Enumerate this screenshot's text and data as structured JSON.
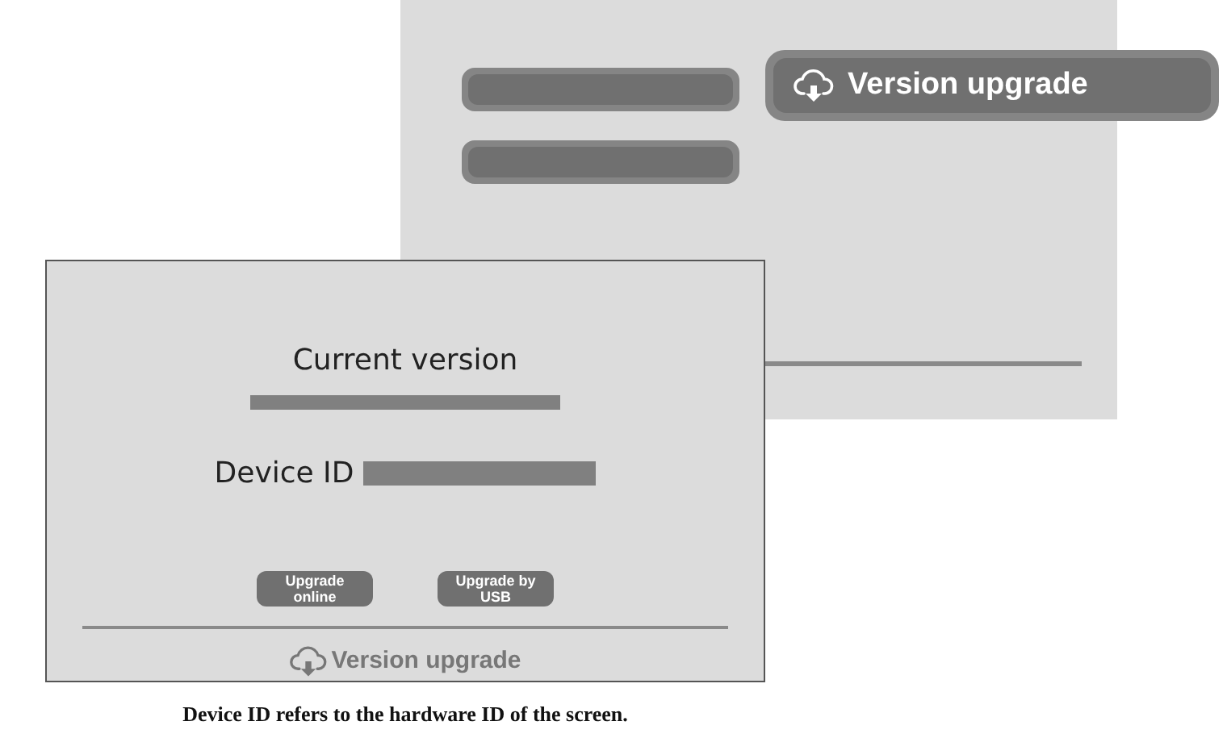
{
  "menu": {
    "items": [
      {
        "kind": "blank",
        "selected": false
      },
      {
        "kind": "blank",
        "selected": false
      },
      {
        "kind": "labeled",
        "label": "Version upgrade",
        "selected": true
      }
    ]
  },
  "dialog": {
    "current_version_label": "Current version",
    "device_id_label": "Device ID",
    "buttons": [
      {
        "label": "Upgrade online"
      },
      {
        "label": "Upgrade by USB"
      }
    ],
    "footer_title": "Version upgrade"
  },
  "caption": "Device ID refers to the hardware ID of the screen."
}
